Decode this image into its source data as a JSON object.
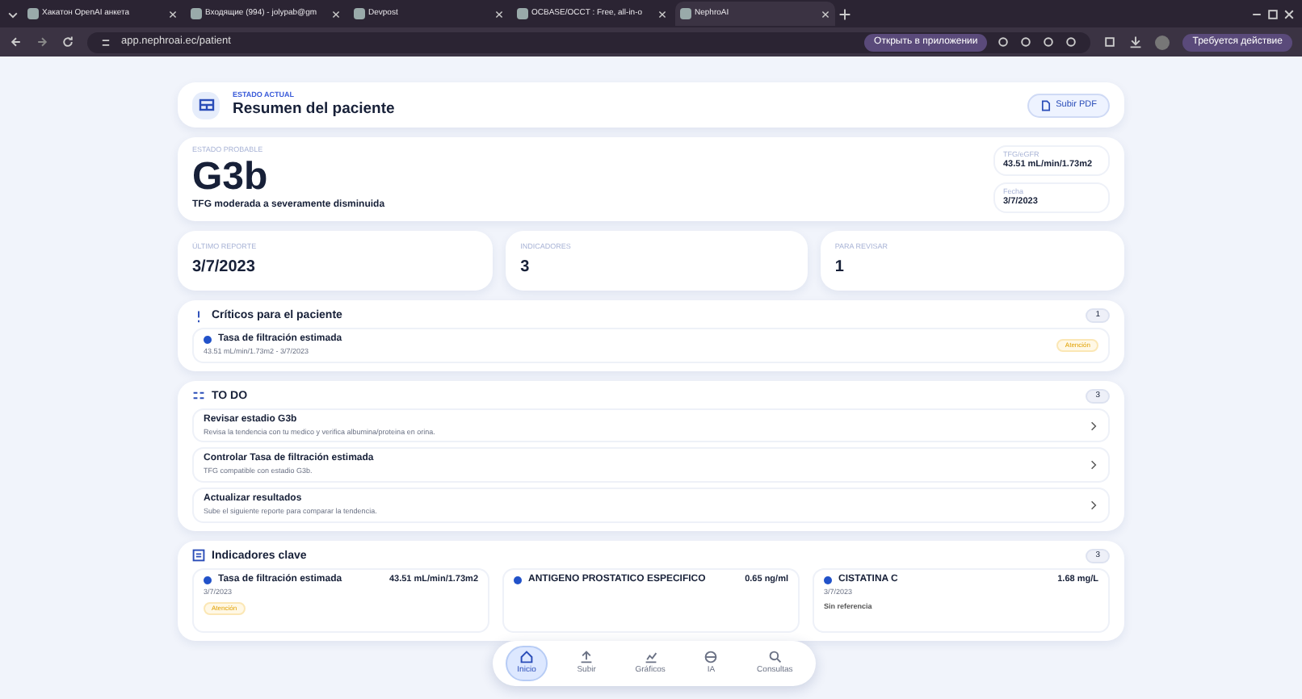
{
  "browser": {
    "tabs": [
      {
        "title": "Хакатон OpenAI анкета",
        "selected": false
      },
      {
        "title": "Входящие (994) - jolypab@gm",
        "selected": false
      },
      {
        "title": "Devpost",
        "selected": false
      },
      {
        "title": "OCBASE/OCCT : Free, all-in-o",
        "selected": false
      },
      {
        "title": "NephroAI",
        "selected": true
      }
    ],
    "url": "app.nephroai.ec/patient",
    "open_app": "Открыть в приложении",
    "action": "Требуется действие"
  },
  "header": {
    "eyebrow": "ESTADO ACTUAL",
    "title": "Resumen del paciente",
    "upload": "Subir PDF"
  },
  "status": {
    "label": "ESTADO PROBABLE",
    "stage": "G3b",
    "description": "TFG moderada a severamente disminuida",
    "facts": [
      {
        "label": "TFG/eGFR",
        "value": "43.51 mL/min/1.73m2"
      },
      {
        "label": "Fecha",
        "value": "3/7/2023"
      }
    ]
  },
  "stats": [
    {
      "label": "ÚLTIMO REPORTE",
      "value": "3/7/2023"
    },
    {
      "label": "INDICADORES",
      "value": "3"
    },
    {
      "label": "PARA REVISAR",
      "value": "1"
    }
  ],
  "critical": {
    "title": "Críticos para el paciente",
    "count": "1",
    "items": [
      {
        "name": "Tasa de filtración estimada",
        "detail": "43.51 mL/min/1.73m2 - 3/7/2023",
        "badge": "Atención"
      }
    ]
  },
  "todo": {
    "title": "TO DO",
    "count": "3",
    "items": [
      {
        "title": "Revisar estadio G3b",
        "detail": "Revisa la tendencia con tu medico y verifica albumina/proteina en orina."
      },
      {
        "title": "Controlar Tasa de filtración estimada",
        "detail": "TFG compatible con estadio G3b."
      },
      {
        "title": "Actualizar resultados",
        "detail": "Sube el siguiente reporte para comparar la tendencia."
      }
    ]
  },
  "indicators": {
    "title": "Indicadores clave",
    "count": "3",
    "items": [
      {
        "name": "Tasa de filtración estimada",
        "value": "43.51 mL/min/1.73m2",
        "date": "3/7/2023",
        "flag": "Atención",
        "kind": "warning"
      },
      {
        "name": "ANTIGENO PROSTATICO ESPECIFICO",
        "value": "0.65 ng/ml",
        "kind": "hidden"
      },
      {
        "name": "CISTATINA C",
        "value": "1.68 mg/L",
        "date": "3/7/2023",
        "flag": "Sin referencia",
        "kind": "plain"
      }
    ]
  },
  "bottom_nav": [
    {
      "label": "Inicio",
      "selected": true
    },
    {
      "label": "Subir",
      "selected": false
    },
    {
      "label": "Gráficos",
      "selected": false
    },
    {
      "label": "IA",
      "selected": false
    },
    {
      "label": "Consultas",
      "selected": false
    }
  ]
}
